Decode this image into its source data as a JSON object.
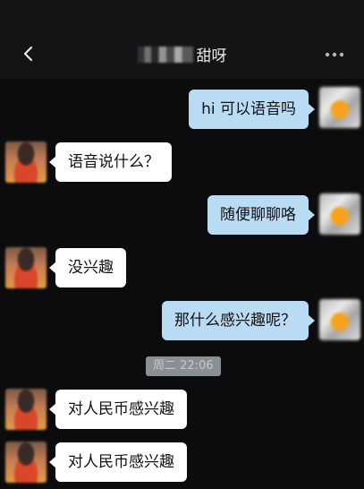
{
  "header": {
    "title": "甜呀",
    "back_icon": "chevron-left-icon",
    "more_icon": "more-dots-icon"
  },
  "messages": [
    {
      "sender": "me",
      "text": "hi 可以语音吗"
    },
    {
      "sender": "her",
      "text": "语音说什么？"
    },
    {
      "sender": "me",
      "text": "随便聊聊咯"
    },
    {
      "sender": "her",
      "text": "没兴趣"
    },
    {
      "sender": "me",
      "text": "那什么感兴趣呢？"
    },
    {
      "sender": "her",
      "text": "对人民币感兴趣"
    },
    {
      "sender": "her",
      "text": "对人民币感兴趣"
    }
  ],
  "timestamp": "周二 22:06",
  "colors": {
    "background": "#0c0c0e",
    "my_bubble": "#b9dcf3",
    "their_bubble": "#ffffff"
  }
}
